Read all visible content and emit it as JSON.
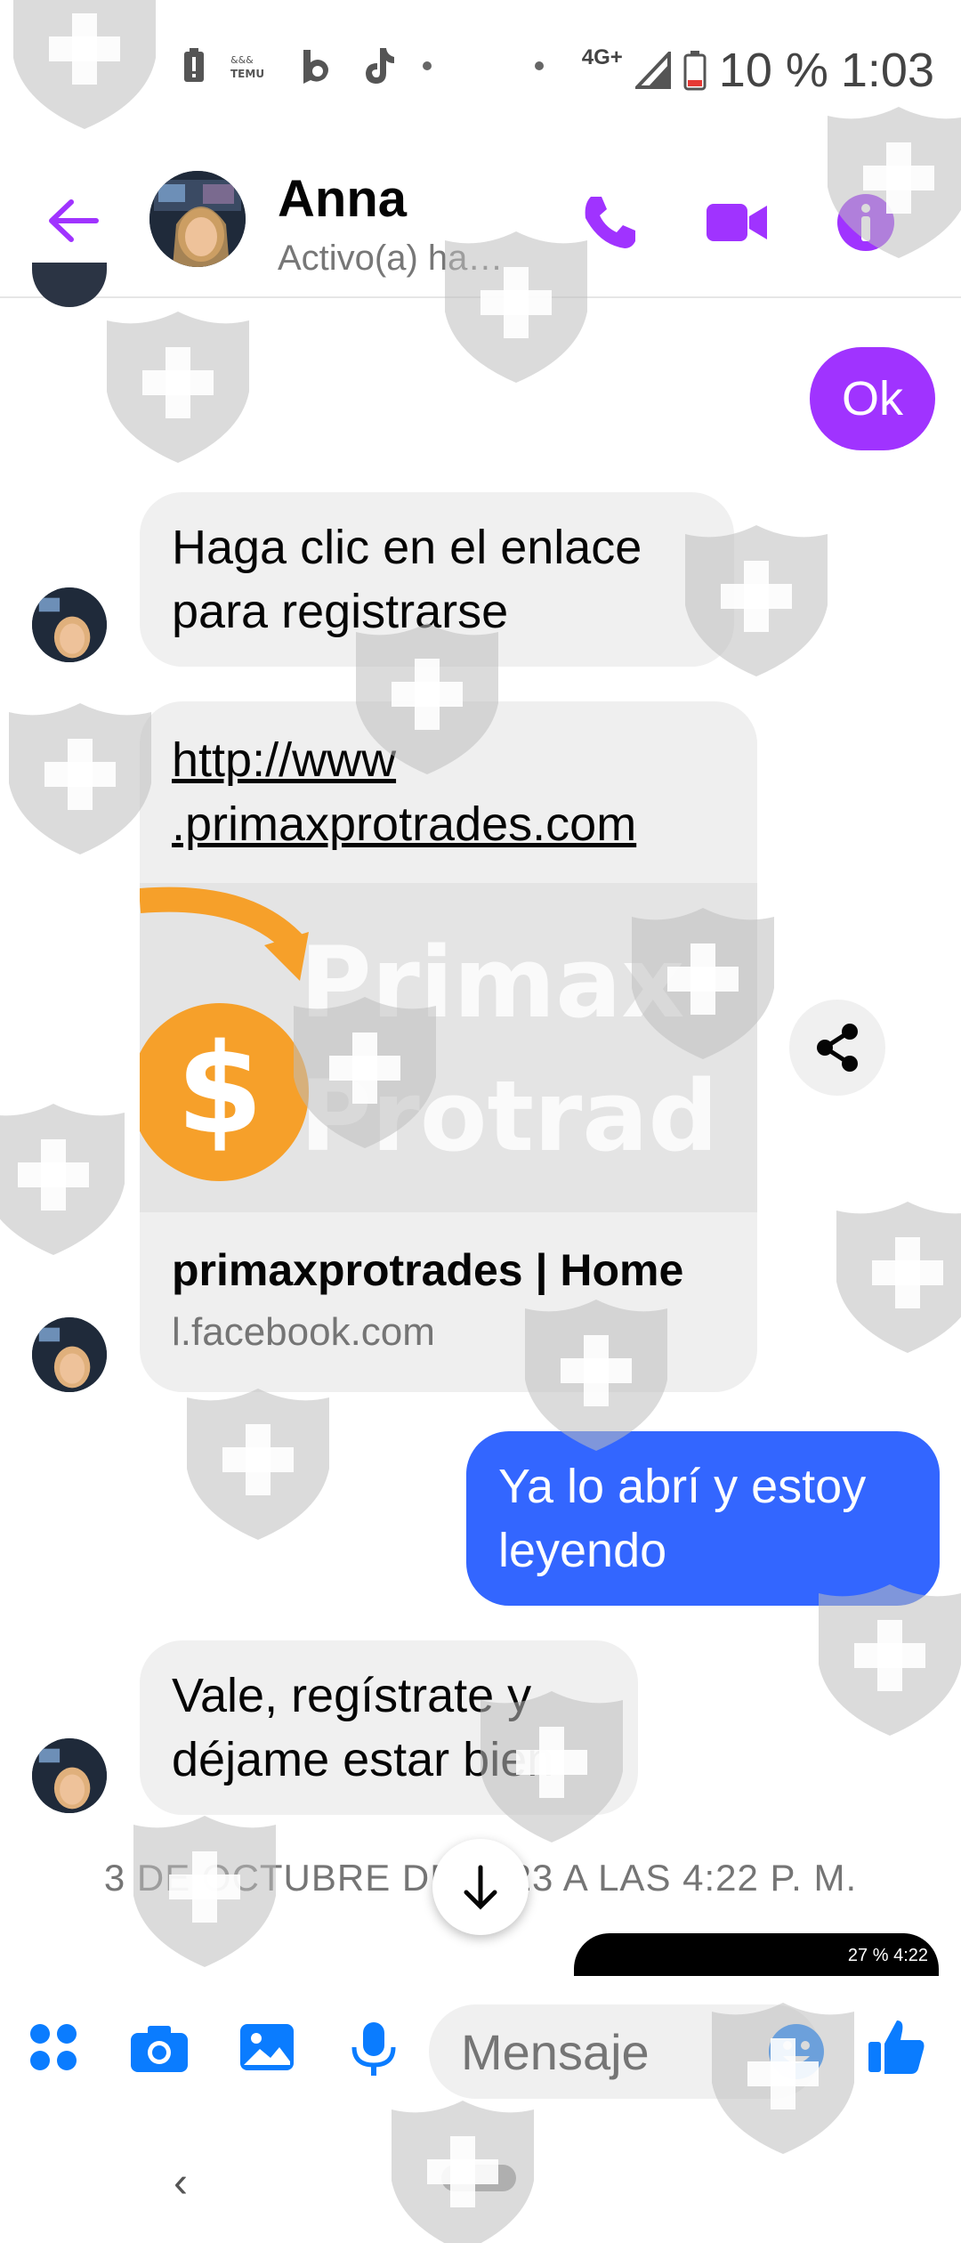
{
  "status_bar": {
    "network": "4G+",
    "battery": "10 %",
    "time": "1:03",
    "notification_icons": [
      "battery-alert-icon",
      "temu-icon",
      "beat-icon",
      "tiktok-icon",
      "dot-icon",
      "dot-icon"
    ]
  },
  "header": {
    "contact_name": "Anna",
    "contact_status": "Activo(a) ha…",
    "icons": [
      "back-arrow-icon",
      "phone-icon",
      "video-icon",
      "info-icon"
    ]
  },
  "messages": [
    {
      "type": "outgoing",
      "text": "Ok"
    },
    {
      "type": "incoming",
      "text": "Haga clic en el enlace para registrarse"
    },
    {
      "type": "incoming_link",
      "url": "http://www\n.primaxprotrades.com",
      "title": "primaxprotrades | Home",
      "domain": "l.facebook.com",
      "preview_text": "Primax Protrad"
    },
    {
      "type": "outgoing",
      "text": "Ya lo abrí y estoy leyendo"
    },
    {
      "type": "incoming",
      "text": "Vale, regístrate y déjame estar bien"
    }
  ],
  "timestamp": "3 DE OCTUBRE DE 2023 A LAS 4:22 P. M.",
  "mini_status": "27 % 4:22",
  "composer": {
    "placeholder": "Mensaje",
    "icons": [
      "apps-icon",
      "camera-icon",
      "gallery-icon",
      "microphone-icon",
      "emoji-icon",
      "like-icon"
    ]
  },
  "colors": {
    "accent_purple": "#a033ff",
    "messenger_blue": "#3366ff",
    "incoming_bubble": "#f0f0f0"
  }
}
